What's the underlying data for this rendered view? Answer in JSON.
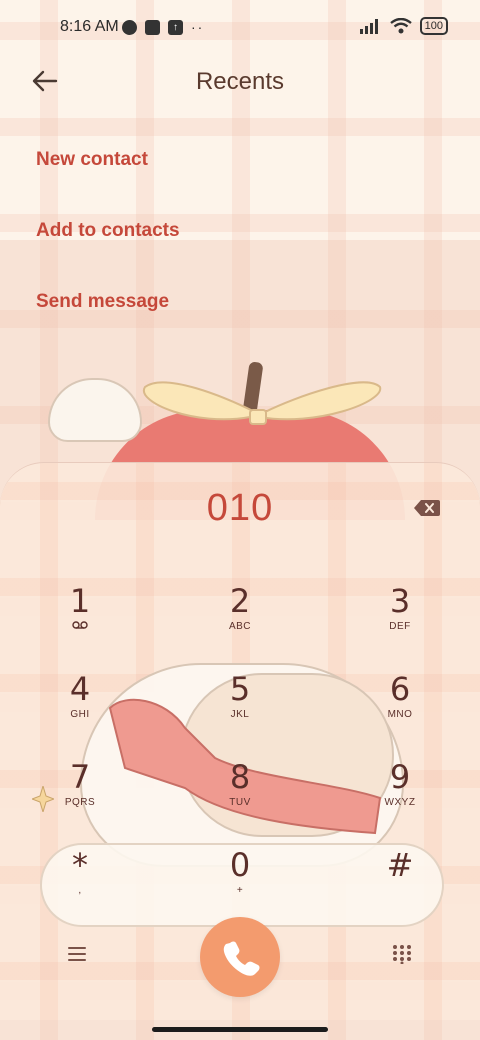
{
  "status": {
    "time": "8:16 AM",
    "battery": "100"
  },
  "header": {
    "title": "Recents"
  },
  "menu": {
    "new_contact": "New contact",
    "add_to_contacts": "Add to contacts",
    "send_message": "Send message"
  },
  "dialer": {
    "number": "010",
    "keys": [
      {
        "digit": "1",
        "letters": "⌂"
      },
      {
        "digit": "2",
        "letters": "ABC"
      },
      {
        "digit": "3",
        "letters": "DEF"
      },
      {
        "digit": "4",
        "letters": "GHI"
      },
      {
        "digit": "5",
        "letters": "JKL"
      },
      {
        "digit": "6",
        "letters": "MNO"
      },
      {
        "digit": "7",
        "letters": "PQRS"
      },
      {
        "digit": "8",
        "letters": "TUV"
      },
      {
        "digit": "9",
        "letters": "WXYZ"
      },
      {
        "digit": "*",
        "letters": ","
      },
      {
        "digit": "0",
        "letters": "+"
      },
      {
        "digit": "#",
        "letters": ""
      }
    ]
  },
  "icons": {
    "back": "back-arrow-icon",
    "backspace": "backspace-icon",
    "menu": "menu-icon",
    "call": "phone-icon",
    "dialpad": "dialpad-icon",
    "voicemail": "voicemail-icon"
  },
  "colors": {
    "accent": "#c5483a",
    "call_button": "#f39b6e",
    "key_text": "#5a2f2a"
  }
}
